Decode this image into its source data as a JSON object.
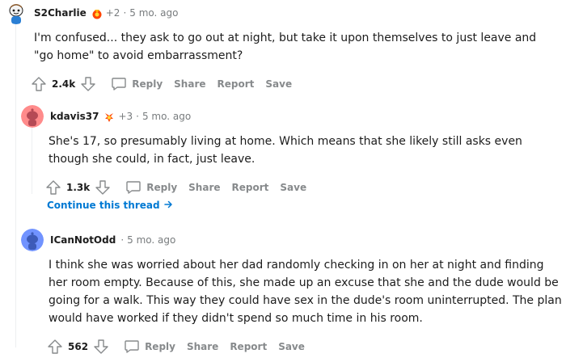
{
  "comments": [
    {
      "username": "S2Charlie",
      "award_count": "+2",
      "separator": "·",
      "time": "5 mo. ago",
      "body": "I'm confused... they ask to go out at night, but take it upon themselves to just leave and \"go home\" to avoid embarrassment?",
      "votes": "2.4k",
      "avatar_color": "#dae0e6"
    },
    {
      "username": "kdavis37",
      "award_count": "+3",
      "separator": "·",
      "time": "5 mo. ago",
      "body": "She's 17, so presumably living at home. Which means that she likely still asks even though she could, in fact, just leave.",
      "votes": "1.3k",
      "avatar_color": "#ff8b8b"
    },
    {
      "username": "ICanNotOdd",
      "separator": "·",
      "time": "5 mo. ago",
      "body": "I think she was worried about her dad randomly checking in on her at night and finding her room empty. Because of this, she made up an excuse that she and the dude would be going for a walk. This way they could have sex in the dude's room uninterrupted. The plan would have worked if they didn't spend so much time in his room.",
      "votes": "562",
      "avatar_color": "#7193ff"
    }
  ],
  "actions": {
    "reply": "Reply",
    "share": "Share",
    "report": "Report",
    "save": "Save"
  },
  "continue_thread": "Continue this thread",
  "icons": {
    "upvote": "upvote-arrow-icon",
    "downvote": "downvote-arrow-icon",
    "reply": "speech-bubble-icon",
    "continue": "arrow-right-icon"
  },
  "colors": {
    "link": "#0079d3",
    "meta": "#787c7e",
    "action": "#878a8c"
  }
}
